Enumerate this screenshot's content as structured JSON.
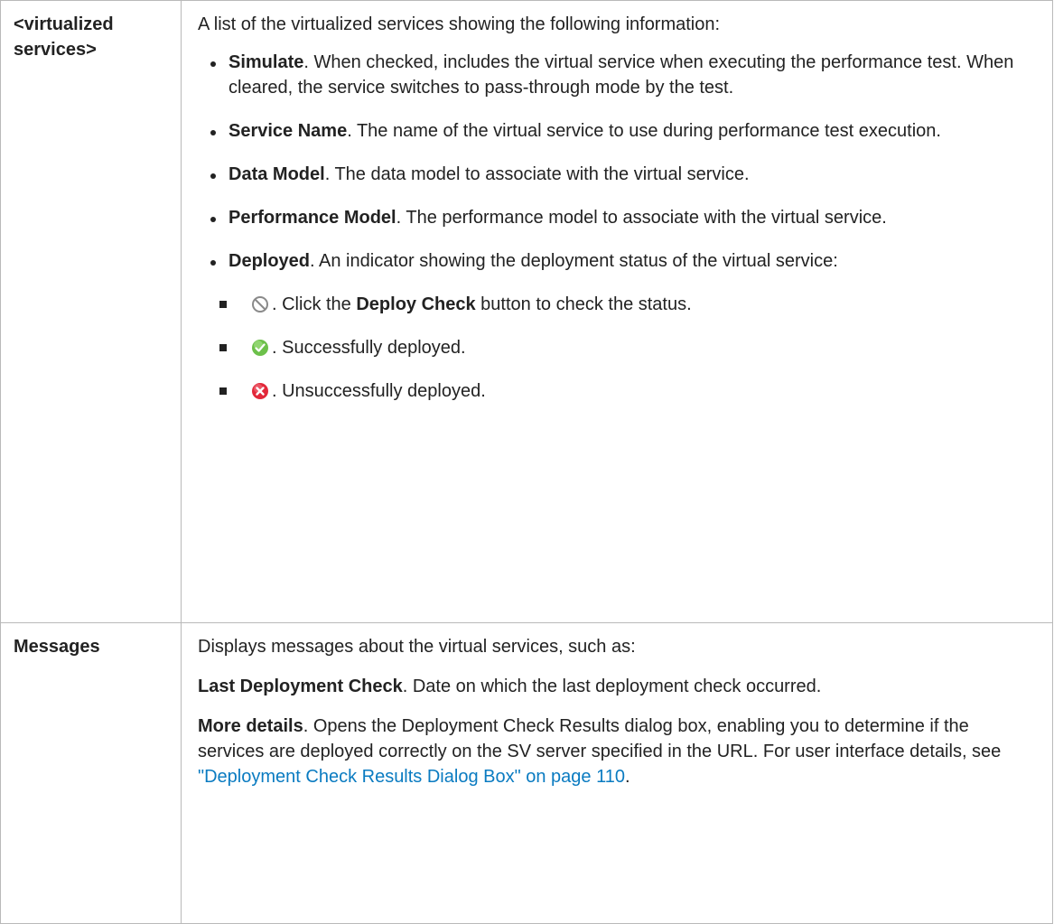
{
  "rows": [
    {
      "label": "<virtualized services>",
      "intro": "A list of the virtualized services showing the following information:",
      "items": [
        {
          "term": "Simulate",
          "desc": ". When checked, includes the virtual service when executing the performance test. When cleared, the service switches to pass-through mode by the test."
        },
        {
          "term": "Service Name",
          "desc": ". The name of the virtual service to use during performance test execution."
        },
        {
          "term": "Data Model",
          "desc": ". The data model to associate with the virtual service."
        },
        {
          "term": "Performance Model",
          "desc": ". The performance model to associate with the virtual service."
        },
        {
          "term": "Deployed",
          "desc": ". An indicator showing the deployment status of the virtual service:"
        }
      ],
      "status_items": [
        {
          "icon": "not-checked-icon",
          "pre": ". Click the ",
          "bold": "Deploy Check",
          "post": " button to check the status."
        },
        {
          "icon": "success-check-icon",
          "text": ". Successfully deployed."
        },
        {
          "icon": "error-x-icon",
          "text": ". Unsuccessfully deployed."
        }
      ]
    },
    {
      "label": "Messages",
      "intro": "Displays messages about the virtual services, such as:",
      "p1_term": "Last Deployment Check",
      "p1_desc": ". Date on which the last deployment check occurred.",
      "p2_term": "More details",
      "p2_desc": ". Opens the Deployment Check Results dialog box, enabling you to determine if the services are deployed correctly on the SV server specified in the URL. For user interface details, see ",
      "p2_link": "\"Deployment Check Results Dialog Box\" on page 110",
      "p2_end": "."
    }
  ],
  "colors": {
    "link": "#0a7bc1",
    "border": "#b9b9b9",
    "success": "#6cc04a",
    "error": "#e2283a",
    "neutral": "#8a8a8a"
  }
}
